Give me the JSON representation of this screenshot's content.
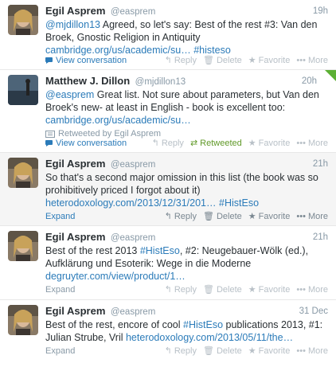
{
  "tweets": [
    {
      "name": "Egil Asprem",
      "handle": "@easprem",
      "time": "19h",
      "text_parts": [
        {
          "t": "link",
          "v": "@mjdillon13"
        },
        {
          "t": "text",
          "v": " Agreed, so let's say: Best of the rest #3: Van den Broek, Gnostic Religion in Antiquity "
        },
        {
          "t": "link",
          "v": "cambridge.org/us/academic/su…"
        },
        {
          "t": "text",
          "v": " "
        },
        {
          "t": "link",
          "v": "#histeso"
        }
      ],
      "expand": "View conversation",
      "reply": "Reply",
      "delete": "Delete",
      "favorite": "Favorite",
      "more": "More"
    },
    {
      "name": "Matthew J. Dillon",
      "handle": "@mjdillon13",
      "time": "20h",
      "text_parts": [
        {
          "t": "link",
          "v": "@easprem"
        },
        {
          "t": "text",
          "v": " Great list. Not sure about parameters, but Van den Broek's new- at least in English - book is excellent too: "
        },
        {
          "t": "link",
          "v": "cambridge.org/us/academic/su…"
        }
      ],
      "retweeted_by": "Retweeted by Egil Asprem",
      "expand": "View conversation",
      "reply": "Reply",
      "retweeted": "Retweeted",
      "favorite": "Favorite",
      "more": "More"
    },
    {
      "name": "Egil Asprem",
      "handle": "@easprem",
      "time": "21h",
      "text_parts": [
        {
          "t": "text",
          "v": "So that's a second major omission in this list (the book was so prohibitively priced I forgot about it) "
        },
        {
          "t": "link",
          "v": "heterodoxology.com/2013/12/31/201…"
        },
        {
          "t": "text",
          "v": " "
        },
        {
          "t": "link",
          "v": "#HistEso"
        }
      ],
      "expand": "Expand",
      "reply": "Reply",
      "delete": "Delete",
      "favorite": "Favorite",
      "more": "More"
    },
    {
      "name": "Egil Asprem",
      "handle": "@easprem",
      "time": "21h",
      "text_parts": [
        {
          "t": "text",
          "v": "Best of the rest 2013 "
        },
        {
          "t": "link",
          "v": "#HistEso"
        },
        {
          "t": "text",
          "v": ", #2: Neugebauer-Wölk (ed.), Aufklärung und Esoterik: Wege in die Moderne  "
        },
        {
          "t": "link",
          "v": "degruyter.com/view/product/1…"
        }
      ],
      "expand": "Expand",
      "reply": "Reply",
      "delete": "Delete",
      "favorite": "Favorite",
      "more": "More"
    },
    {
      "name": "Egil Asprem",
      "handle": "@easprem",
      "time": "31 Dec",
      "text_parts": [
        {
          "t": "text",
          "v": "Best of the rest, encore of cool "
        },
        {
          "t": "link",
          "v": "#HistEso"
        },
        {
          "t": "text",
          "v": " publications 2013, #1: Julian Strube, Vril "
        },
        {
          "t": "link",
          "v": "heterodoxology.com/2013/05/11/the…"
        }
      ],
      "expand": "Expand",
      "reply": "Reply",
      "delete": "Delete",
      "favorite": "Favorite",
      "more": "More"
    }
  ],
  "colors": {
    "link": "#2b7bb9",
    "retweet_green": "#609928",
    "muted": "#8899a6",
    "alt_background": "#f5f5f5"
  },
  "icons": {
    "conversation": "speech-bubble-icon",
    "reply": "reply-arrow-icon",
    "delete": "trash-icon",
    "favorite": "star-icon",
    "more": "ellipsis-icon",
    "retweet": "retweet-arrows-icon"
  }
}
